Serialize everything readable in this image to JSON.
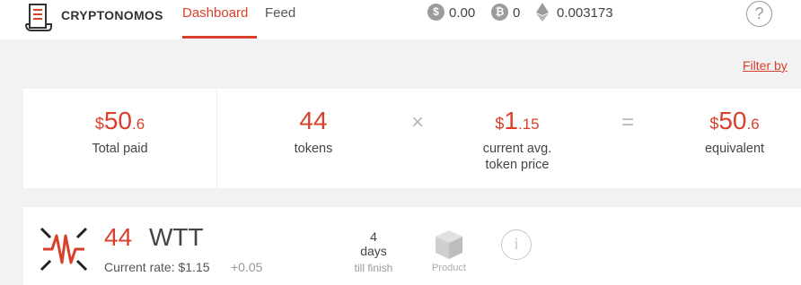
{
  "header": {
    "brand": "CRYPTONOMOS",
    "tabs": [
      {
        "label": "Dashboard",
        "active": true
      },
      {
        "label": "Feed",
        "active": false
      }
    ],
    "balances": [
      {
        "icon": "dollar-coin-icon",
        "symbol": "$",
        "value": "0.00"
      },
      {
        "icon": "bitcoin-icon",
        "symbol": "₿",
        "value": "0"
      },
      {
        "icon": "ethereum-icon",
        "symbol": "",
        "value": "0.003173"
      }
    ],
    "help_label": "?"
  },
  "filter_link": "Filter by",
  "summary": {
    "total_paid": {
      "currency": "$",
      "whole": "50",
      "decimal": ".6",
      "label": "Total paid"
    },
    "tokens": {
      "value": "44",
      "label": "tokens"
    },
    "times": "×",
    "price": {
      "currency": "$",
      "whole": "1",
      "decimal": ".15",
      "label_line1": "current avg.",
      "label_line2": "token price"
    },
    "equals": "=",
    "equivalent": {
      "currency": "$",
      "whole": "50",
      "decimal": ".6",
      "label": "equivalent"
    }
  },
  "token": {
    "amount": "44",
    "symbol": "WTT",
    "rate_label": "Current rate: $1.15",
    "rate_delta": "+0.05",
    "days_value": "4",
    "days_label": "days",
    "till_label": "till finish",
    "product_label": "Product",
    "info_label": "i"
  },
  "colors": {
    "accent": "#d9402b",
    "background": "#f3f2f2",
    "card": "#ffffff",
    "muted": "#9b9b9b"
  }
}
